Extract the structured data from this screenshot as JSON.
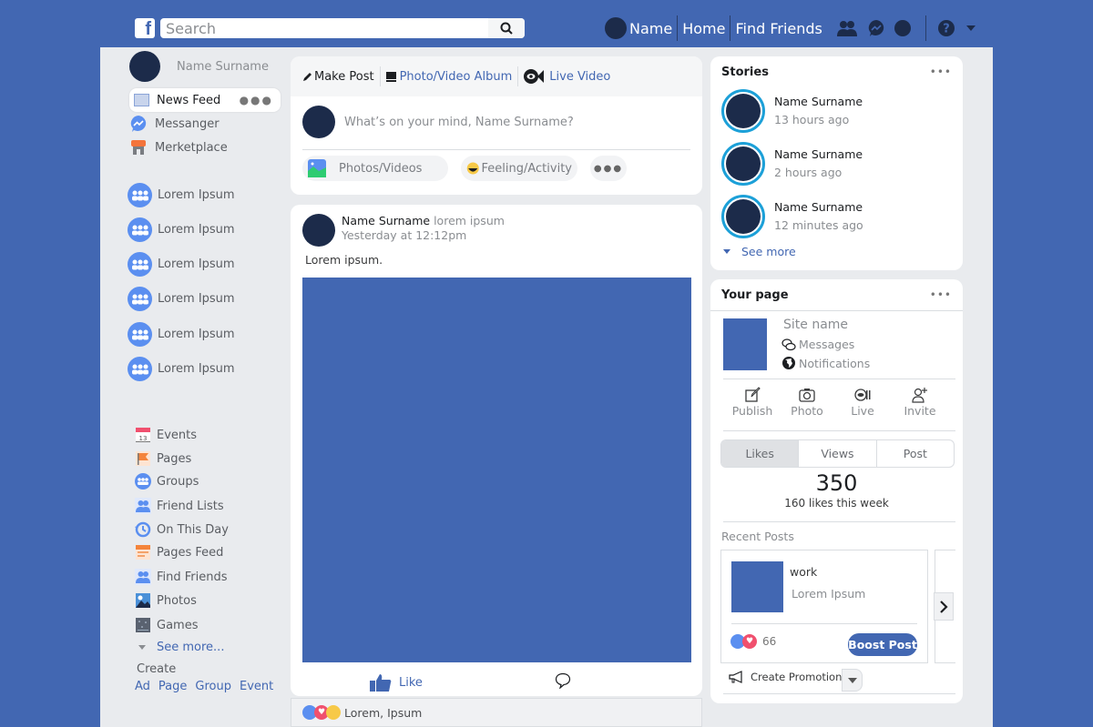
{
  "header": {
    "search_placeholder": "Search",
    "user_name": "Name",
    "nav": [
      "Home",
      "Find Friends"
    ],
    "icons": [
      "friends-icon",
      "messenger-icon",
      "notifications-icon",
      "help-icon",
      "caret-down-icon"
    ]
  },
  "left_sidebar": {
    "profile_name": "Name Surname",
    "primary": [
      {
        "label": "News Feed",
        "icon": "news-feed-icon",
        "active": true
      },
      {
        "label": "Messanger",
        "icon": "messenger-icon"
      },
      {
        "label": "Merketplace",
        "icon": "marketplace-icon"
      }
    ],
    "groups": [
      "Lorem Ipsum",
      "Lorem Ipsum",
      "Lorem Ipsum",
      "Lorem Ipsum",
      "Lorem Ipsum",
      "Lorem Ipsum"
    ],
    "explore": [
      {
        "label": "Events",
        "icon": "calendar-icon",
        "badge": "13"
      },
      {
        "label": "Pages",
        "icon": "flag-icon"
      },
      {
        "label": "Groups",
        "icon": "groups-icon"
      },
      {
        "label": "Friend Lists",
        "icon": "friend-list-icon"
      },
      {
        "label": "On This Day",
        "icon": "history-icon"
      },
      {
        "label": "Pages Feed",
        "icon": "pages-feed-icon"
      },
      {
        "label": "Find Friends",
        "icon": "find-friends-icon"
      },
      {
        "label": "Photos",
        "icon": "photos-icon"
      },
      {
        "label": "Games",
        "icon": "games-icon"
      }
    ],
    "see_more": "See more...",
    "create_label": "Create",
    "create_links": [
      "Ad",
      "Page",
      "Group",
      "Event"
    ]
  },
  "composer": {
    "tabs": [
      "Make Post",
      "Photo/Video Album",
      "Live Video"
    ],
    "placeholder": "What’s on your mind, Name Surname?",
    "actions": [
      "Photos/Videos",
      "Feeling/Activity"
    ]
  },
  "post": {
    "author": "Name Surname",
    "subtitle": "lorem ipsum",
    "time": "Yesterday at 12:12pm",
    "text": "Lorem ipsum.",
    "like_label": "Like",
    "reactions_text": "Lorem, Ipsum"
  },
  "stories": {
    "title": "Stories",
    "items": [
      {
        "name": "Name Surname",
        "time": "13 hours ago"
      },
      {
        "name": "Name Surname",
        "time": "2 hours ago"
      },
      {
        "name": "Name Surname",
        "time": "12 minutes ago"
      }
    ],
    "see_more": "See more"
  },
  "your_page": {
    "title": "Your page",
    "site_name": "Site name",
    "links": [
      "Messages",
      "Notifications"
    ],
    "actions": [
      "Publish",
      "Photo",
      "Live",
      "Invite"
    ],
    "tabs": [
      "Likes",
      "Views",
      "Post"
    ],
    "active_tab": "Likes",
    "count": "350",
    "count_caption": "160 likes this week",
    "recent_label": "Recent Posts",
    "recent_post": {
      "title": "work",
      "subtitle": "Lorem Ipsum",
      "reactions": "66",
      "boost_label": "Boost Post"
    },
    "promotion_label": "Create Promotion"
  },
  "colors": {
    "brand": "#4267b2",
    "avatar": "#1c2b4a",
    "story_ring": "#1ca0d8"
  }
}
